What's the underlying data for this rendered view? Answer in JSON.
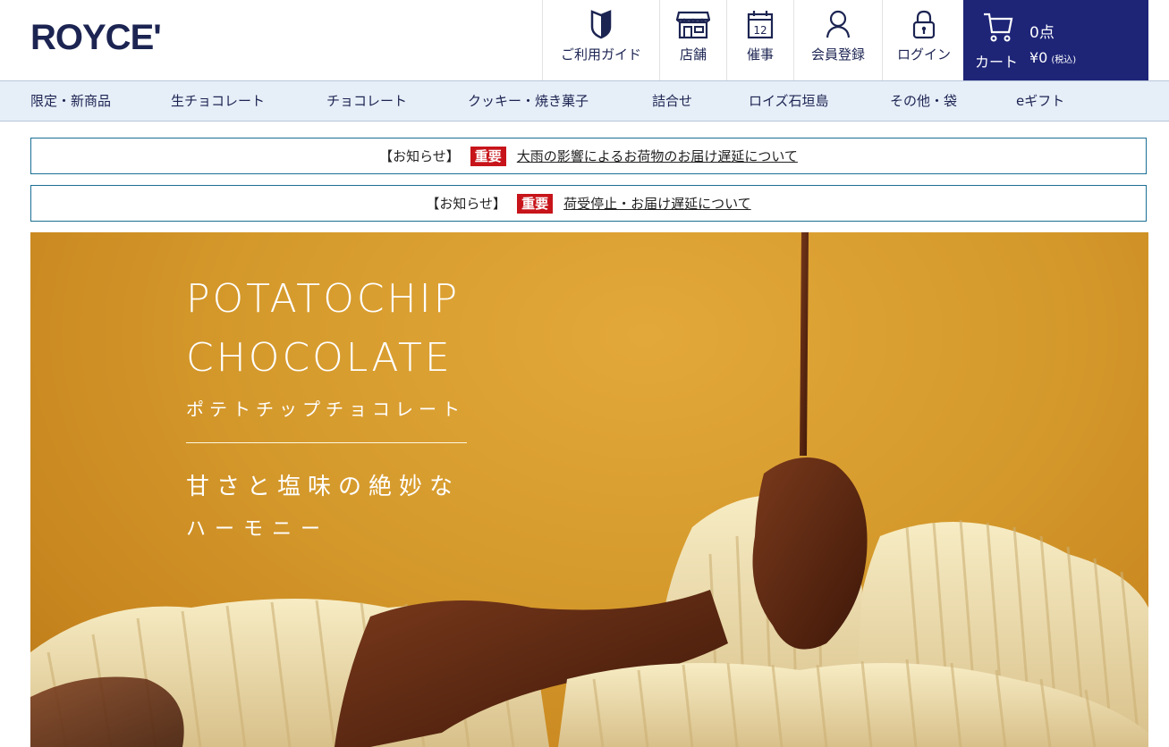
{
  "header": {
    "logo": "ROYCE'",
    "icon_nav": [
      {
        "label": "ご利用ガイド",
        "icon": "guide-shield-icon"
      },
      {
        "label": "店舗",
        "icon": "store-icon"
      },
      {
        "label": "催事",
        "icon": "calendar-icon"
      },
      {
        "label": "会員登録",
        "icon": "user-icon"
      },
      {
        "label": "ログイン",
        "icon": "lock-icon"
      }
    ],
    "calendar_day": "12",
    "cart": {
      "count": "0点",
      "label": "カート",
      "price": "¥0",
      "tax": "(税込)"
    }
  },
  "category_nav": [
    "限定・新商品",
    "生チョコレート",
    "チョコレート",
    "クッキー・焼き菓子",
    "詰合せ",
    "ロイズ石垣島",
    "その他・袋",
    "eギフト"
  ],
  "notices": [
    {
      "prefix": "【お知らせ】",
      "badge": "重要",
      "link": "大雨の影響によるお荷物のお届け遅延について"
    },
    {
      "prefix": "【お知らせ】",
      "badge": "重要",
      "link": "荷受停止・お届け遅延について"
    }
  ],
  "hero": {
    "title_line1": "POTATOCHIP",
    "title_line2": "CHOCOLATE",
    "subtitle": "ポテトチップチョコレート",
    "tagline1": "甘さと塩味の絶妙な",
    "tagline2": "ハーモニー"
  },
  "colors": {
    "brand_navy": "#1c2452",
    "cart_bg": "#1e2577",
    "badge_red": "#c7141a",
    "nav_bg": "#e6eef8"
  }
}
